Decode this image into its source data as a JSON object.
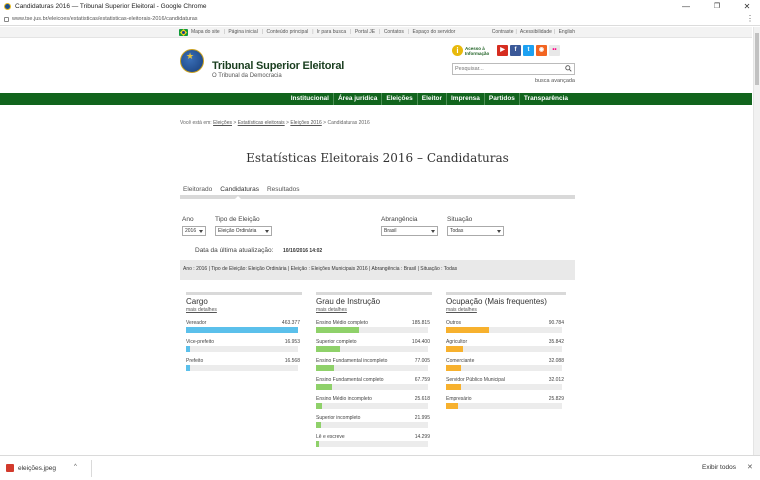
{
  "window": {
    "title": "Candidaturas 2016 — Tribunal Superior Eleitoral - Google Chrome",
    "url": "www.tse.jus.br/eleicoes/estatisticas/estatisticas-eleitorais-2016/candidaturas",
    "minimize": "—",
    "maximize": "❐",
    "close": "✕",
    "menu": "⋮"
  },
  "utilbar": {
    "left_links": [
      "Mapa do site",
      "Página inicial",
      "Conteúdo principal",
      "Ir para busca",
      "Portal JE",
      "Contatos",
      "Espaço do servidor"
    ],
    "right_links": [
      "Contraste",
      "Acessibilidade",
      "English"
    ]
  },
  "header": {
    "brand": "Tribunal Superior Eleitoral",
    "brand_sub": "O Tribunal da Democracia",
    "acesso_line1": "Acesso à",
    "acesso_line2": "Informação",
    "social": [
      "▶",
      "f",
      "t",
      "◉",
      "••"
    ],
    "search_placeholder": "Pesquisar...",
    "busca_avancada": "busca avançada"
  },
  "nav": [
    "Institucional",
    "Área jurídica",
    "Eleições",
    "Eleitor",
    "Imprensa",
    "Partidos",
    "Transparência"
  ],
  "breadcrumb": {
    "prefix": "Você está em:",
    "items": [
      "Eleições",
      "Estatísticas eleitorais",
      "Eleições 2016"
    ],
    "current": "Candidaturas 2016"
  },
  "page_title": "Estatísticas Eleitorais 2016 – Candidaturas",
  "tabs": [
    "Eleitorado",
    "Candidaturas",
    "Resultados"
  ],
  "filters": {
    "ano_label": "Ano",
    "ano_value": "2016",
    "tipo_label": "Tipo de Eleição",
    "tipo_value": "Eleição Ordinária",
    "abrangencia_label": "Abrangência",
    "abrangencia_value": "Brasil",
    "situacao_label": "Situação",
    "situacao_value": "Todas"
  },
  "last_update": {
    "label": "Data da última atualização:",
    "value": "10/10/2016 14:02"
  },
  "summary": "Ano : 2016 | Tipo de Eleição: Eleição Ordinária | Eleição : Eleições Municipais 2016 | Abrangência : Brasil | Situação : Todas",
  "colors": {
    "cargo_bar": "#5bc0eb",
    "grau_bar": "#8fd16a",
    "ocup_bar": "#f7b12e",
    "nav_green": "#11641d"
  },
  "cargo": {
    "title": "Cargo",
    "more": "mais detalhes",
    "rows": [
      {
        "label": "Vereador",
        "value": "463.377",
        "fraction": 1.0
      },
      {
        "label": "Vice-prefeito",
        "value": "16.953",
        "fraction": 0.037
      },
      {
        "label": "Prefeito",
        "value": "16.568",
        "fraction": 0.036
      }
    ]
  },
  "grau": {
    "title": "Grau de Instrução",
    "more": "mais detalhes",
    "rows": [
      {
        "label": "Ensino Médio completo",
        "value": "185.815",
        "fraction": 0.38
      },
      {
        "label": "Superior completo",
        "value": "104.400",
        "fraction": 0.21
      },
      {
        "label": "Ensino Fundamental incompleto",
        "value": "77.005",
        "fraction": 0.16
      },
      {
        "label": "Ensino Fundamental completo",
        "value": "67.759",
        "fraction": 0.14
      },
      {
        "label": "Ensino Médio incompleto",
        "value": "25.618",
        "fraction": 0.05
      },
      {
        "label": "Superior incompleto",
        "value": "21.995",
        "fraction": 0.045
      },
      {
        "label": "Lê e escreve",
        "value": "14.299",
        "fraction": 0.03
      }
    ]
  },
  "ocupacao": {
    "title": "Ocupação (Mais frequentes)",
    "more": "mais detalhes",
    "rows": [
      {
        "label": "Outros",
        "value": "90.784",
        "fraction": 0.37
      },
      {
        "label": "Agricultor",
        "value": "35.842",
        "fraction": 0.145
      },
      {
        "label": "Comerciante",
        "value": "32.088",
        "fraction": 0.13
      },
      {
        "label": "Servidor Público Municipal",
        "value": "32.012",
        "fraction": 0.13
      },
      {
        "label": "Empresário",
        "value": "25.829",
        "fraction": 0.105
      }
    ]
  },
  "downloads": {
    "file": "eleições.jpeg",
    "caret": "^",
    "show_all": "Exibir todos",
    "close": "✕"
  }
}
